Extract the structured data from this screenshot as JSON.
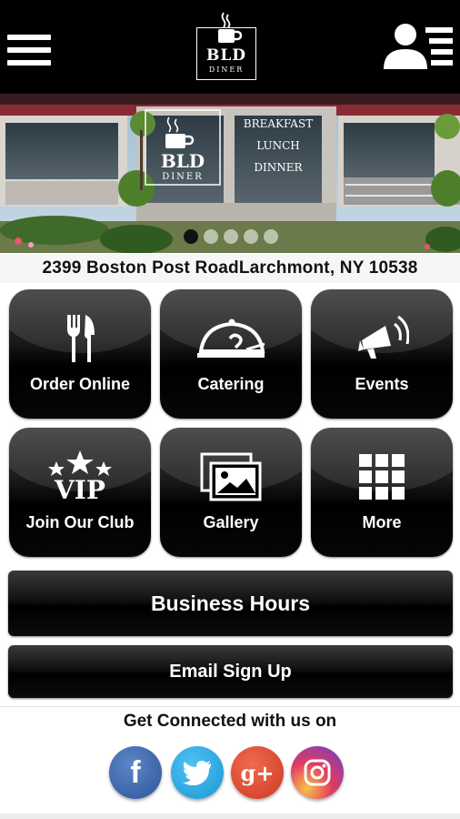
{
  "header": {
    "menu_icon": "hamburger-menu-icon",
    "logo_text": "BLD",
    "logo_subtext": "DINER",
    "profile_icon": "user-menu-icon"
  },
  "hero": {
    "sign_logo_text": "BLD",
    "sign_logo_subtext": "DINER",
    "sign_menu": [
      "BREAKFAST",
      "LUNCH",
      "DINNER"
    ],
    "slides_total": 5,
    "active_slide": 1
  },
  "address": "2399 Boston Post RoadLarchmont, NY 10538",
  "tiles": [
    {
      "label": "Order Online",
      "icon": "fork-knife-icon"
    },
    {
      "label": "Catering",
      "icon": "cloche-icon"
    },
    {
      "label": "Events",
      "icon": "megaphone-icon"
    },
    {
      "label": "Join Our Club",
      "icon": "vip-stars-icon",
      "icon_text": "VIP"
    },
    {
      "label": "Gallery",
      "icon": "gallery-icon"
    },
    {
      "label": "More",
      "icon": "grid-icon"
    }
  ],
  "buttons": {
    "business_hours": "Business Hours",
    "email_signup": "Email Sign Up"
  },
  "social": {
    "heading": "Get Connected with us on",
    "networks": [
      {
        "name": "facebook",
        "glyph": "f",
        "color": "#3b5fa8"
      },
      {
        "name": "twitter",
        "glyph": "",
        "color": "#1da1f2"
      },
      {
        "name": "google-plus",
        "glyph": "g+",
        "color": "#dd4b39"
      },
      {
        "name": "instagram",
        "glyph": "",
        "color": "#c13584"
      }
    ]
  }
}
